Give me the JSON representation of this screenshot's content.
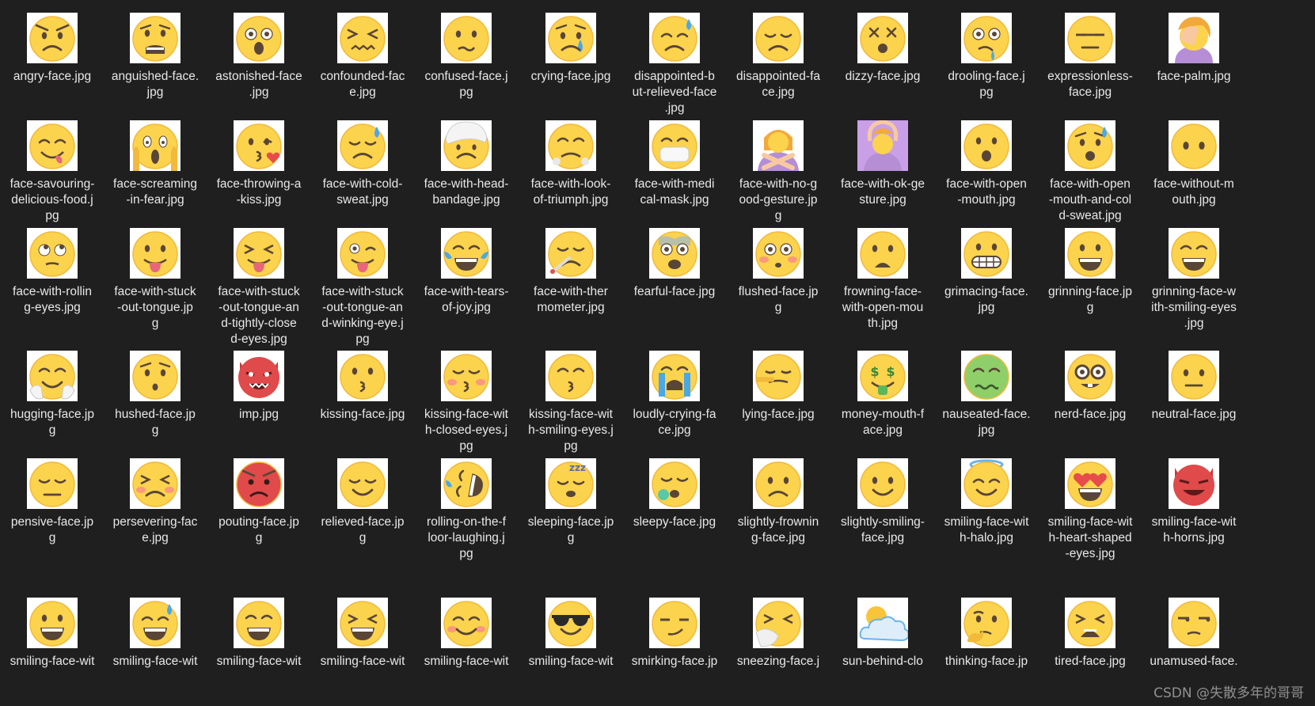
{
  "files": [
    {
      "name": "angry-face.jpg",
      "label": "angry-face.jpg",
      "icon": "angry"
    },
    {
      "name": "anguished-face.jpg",
      "label": "anguished-face.\njpg",
      "icon": "anguished"
    },
    {
      "name": "astonished-face.jpg",
      "label": "astonished-face\n.jpg",
      "icon": "astonished"
    },
    {
      "name": "confounded-face.jpg",
      "label": "confounded-fac\ne.jpg",
      "icon": "confounded"
    },
    {
      "name": "confused-face.jpg",
      "label": "confused-face.j\npg",
      "icon": "confused"
    },
    {
      "name": "crying-face.jpg",
      "label": "crying-face.jpg",
      "icon": "crying"
    },
    {
      "name": "disappointed-but-relieved-face.jpg",
      "label": "disappointed-b\nut-relieved-face\n.jpg",
      "icon": "disappointed-relieved"
    },
    {
      "name": "disappointed-face.jpg",
      "label": "disappointed-fa\nce.jpg",
      "icon": "disappointed"
    },
    {
      "name": "dizzy-face.jpg",
      "label": "dizzy-face.jpg",
      "icon": "dizzy"
    },
    {
      "name": "drooling-face.jpg",
      "label": "drooling-face.j\npg",
      "icon": "drooling"
    },
    {
      "name": "expressionless-face.jpg",
      "label": "expressionless-\nface.jpg",
      "icon": "expressionless"
    },
    {
      "name": "face-palm.jpg",
      "label": "face-palm.jpg",
      "icon": "face-palm"
    },
    {
      "name": "face-savouring-delicious-food.jpg",
      "label": "face-savouring-\ndelicious-food.j\npg",
      "icon": "savouring"
    },
    {
      "name": "face-screaming-in-fear.jpg",
      "label": "face-screaming\n-in-fear.jpg",
      "icon": "screaming"
    },
    {
      "name": "face-throwing-a-kiss.jpg",
      "label": "face-throwing-a\n-kiss.jpg",
      "icon": "throwing-kiss"
    },
    {
      "name": "face-with-cold-sweat.jpg",
      "label": "face-with-cold-\nsweat.jpg",
      "icon": "cold-sweat"
    },
    {
      "name": "face-with-head-bandage.jpg",
      "label": "face-with-head-\nbandage.jpg",
      "icon": "head-bandage"
    },
    {
      "name": "face-with-look-of-triumph.jpg",
      "label": "face-with-look-\nof-triumph.jpg",
      "icon": "triumph"
    },
    {
      "name": "face-with-medical-mask.jpg",
      "label": "face-with-medi\ncal-mask.jpg",
      "icon": "medical-mask"
    },
    {
      "name": "face-with-no-good-gesture.jpg",
      "label": "face-with-no-g\nood-gesture.jp\ng",
      "icon": "no-good-gesture"
    },
    {
      "name": "face-with-ok-gesture.jpg",
      "label": "face-with-ok-ge\nsture.jpg",
      "icon": "ok-gesture"
    },
    {
      "name": "face-with-open-mouth.jpg",
      "label": "face-with-open\n-mouth.jpg",
      "icon": "open-mouth"
    },
    {
      "name": "face-with-open-mouth-and-cold-sweat.jpg",
      "label": "face-with-open\n-mouth-and-col\nd-sweat.jpg",
      "icon": "open-mouth-cold-sweat"
    },
    {
      "name": "face-without-mouth.jpg",
      "label": "face-without-m\nouth.jpg",
      "icon": "without-mouth"
    },
    {
      "name": "face-with-rolling-eyes.jpg",
      "label": "face-with-rollin\ng-eyes.jpg",
      "icon": "rolling-eyes"
    },
    {
      "name": "face-with-stuck-out-tongue.jpg",
      "label": "face-with-stuck\n-out-tongue.jp\ng",
      "icon": "stuck-out-tongue"
    },
    {
      "name": "face-with-stuck-out-tongue-and-tightly-closed-eyes.jpg",
      "label": "face-with-stuck\n-out-tongue-an\nd-tightly-close\nd-eyes.jpg",
      "icon": "tongue-closed-eyes"
    },
    {
      "name": "face-with-stuck-out-tongue-and-winking-eye.jpg",
      "label": "face-with-stuck\n-out-tongue-an\nd-winking-eye.j\npg",
      "icon": "tongue-wink"
    },
    {
      "name": "face-with-tears-of-joy.jpg",
      "label": "face-with-tears-\nof-joy.jpg",
      "icon": "tears-of-joy"
    },
    {
      "name": "face-with-thermometer.jpg",
      "label": "face-with-ther\nmometer.jpg",
      "icon": "thermometer"
    },
    {
      "name": "fearful-face.jpg",
      "label": "fearful-face.jpg",
      "icon": "fearful"
    },
    {
      "name": "flushed-face.jpg",
      "label": "flushed-face.jp\ng",
      "icon": "flushed"
    },
    {
      "name": "frowning-face-with-open-mouth.jpg",
      "label": "frowning-face-\nwith-open-mou\nth.jpg",
      "icon": "frowning-open-mouth"
    },
    {
      "name": "grimacing-face.jpg",
      "label": "grimacing-face.\njpg",
      "icon": "grimacing"
    },
    {
      "name": "grinning-face.jpg",
      "label": "grinning-face.jp\ng",
      "icon": "grinning"
    },
    {
      "name": "grinning-face-with-smiling-eyes.jpg",
      "label": "grinning-face-w\nith-smiling-eyes\n.jpg",
      "icon": "grinning-smiling-eyes"
    },
    {
      "name": "hugging-face.jpg",
      "label": "hugging-face.jp\ng",
      "icon": "hugging"
    },
    {
      "name": "hushed-face.jpg",
      "label": "hushed-face.jp\ng",
      "icon": "hushed"
    },
    {
      "name": "imp.jpg",
      "label": "imp.jpg",
      "icon": "imp"
    },
    {
      "name": "kissing-face.jpg",
      "label": "kissing-face.jpg",
      "icon": "kissing"
    },
    {
      "name": "kissing-face-with-closed-eyes.jpg",
      "label": "kissing-face-wit\nh-closed-eyes.j\npg",
      "icon": "kissing-closed-eyes"
    },
    {
      "name": "kissing-face-with-smiling-eyes.jpg",
      "label": "kissing-face-wit\nh-smiling-eyes.j\npg",
      "icon": "kissing-smiling-eyes"
    },
    {
      "name": "loudly-crying-face.jpg",
      "label": "loudly-crying-fa\nce.jpg",
      "icon": "loudly-crying"
    },
    {
      "name": "lying-face.jpg",
      "label": "lying-face.jpg",
      "icon": "lying"
    },
    {
      "name": "money-mouth-face.jpg",
      "label": "money-mouth-f\nace.jpg",
      "icon": "money-mouth"
    },
    {
      "name": "nauseated-face.jpg",
      "label": "nauseated-face.\njpg",
      "icon": "nauseated"
    },
    {
      "name": "nerd-face.jpg",
      "label": "nerd-face.jpg",
      "icon": "nerd"
    },
    {
      "name": "neutral-face.jpg",
      "label": "neutral-face.jpg",
      "icon": "neutral"
    },
    {
      "name": "pensive-face.jpg",
      "label": "pensive-face.jp\ng",
      "icon": "pensive"
    },
    {
      "name": "persevering-face.jpg",
      "label": "persevering-fac\ne.jpg",
      "icon": "persevering"
    },
    {
      "name": "pouting-face.jpg",
      "label": "pouting-face.jp\ng",
      "icon": "pouting"
    },
    {
      "name": "relieved-face.jpg",
      "label": "relieved-face.jp\ng",
      "icon": "relieved"
    },
    {
      "name": "rolling-on-the-floor-laughing.jpg",
      "label": "rolling-on-the-f\nloor-laughing.j\npg",
      "icon": "rofl"
    },
    {
      "name": "sleeping-face.jpg",
      "label": "sleeping-face.jp\ng",
      "icon": "sleeping"
    },
    {
      "name": "sleepy-face.jpg",
      "label": "sleepy-face.jpg",
      "icon": "sleepy"
    },
    {
      "name": "slightly-frowning-face.jpg",
      "label": "slightly-frownin\ng-face.jpg",
      "icon": "slightly-frowning"
    },
    {
      "name": "slightly-smiling-face.jpg",
      "label": "slightly-smiling-\nface.jpg",
      "icon": "slightly-smiling"
    },
    {
      "name": "smiling-face-with-halo.jpg",
      "label": "smiling-face-wit\nh-halo.jpg",
      "icon": "halo"
    },
    {
      "name": "smiling-face-with-heart-shaped-eyes.jpg",
      "label": "smiling-face-wit\nh-heart-shaped\n-eyes.jpg",
      "icon": "heart-eyes"
    },
    {
      "name": "smiling-face-with-horns.jpg",
      "label": "smiling-face-wit\nh-horns.jpg",
      "icon": "horns"
    },
    {
      "name": "smiling-face-wit…",
      "label": "smiling-face-wit",
      "icon": "smiling-open-mouth"
    },
    {
      "name": "smiling-face-wit…",
      "label": "smiling-face-wit",
      "icon": "smiling-cold-sweat"
    },
    {
      "name": "smiling-face-wit…",
      "label": "smiling-face-wit",
      "icon": "smiling-eyes-open"
    },
    {
      "name": "smiling-face-wit…",
      "label": "smiling-face-wit",
      "icon": "laughing"
    },
    {
      "name": "smiling-face-wit…",
      "label": "smiling-face-wit",
      "icon": "blush"
    },
    {
      "name": "smiling-face-wit…",
      "label": "smiling-face-wit",
      "icon": "sunglasses"
    },
    {
      "name": "smirking-face.jp…",
      "label": "smirking-face.jp",
      "icon": "smirking"
    },
    {
      "name": "sneezing-face.j…",
      "label": "sneezing-face.j",
      "icon": "sneezing"
    },
    {
      "name": "sun-behind-clo…",
      "label": "sun-behind-clo",
      "icon": "sun-cloud"
    },
    {
      "name": "thinking-face.jp…",
      "label": "thinking-face.jp",
      "icon": "thinking"
    },
    {
      "name": "tired-face.jpg",
      "label": "tired-face.jpg",
      "icon": "tired"
    },
    {
      "name": "unamused-face.…",
      "label": "unamused-face.",
      "icon": "unamused"
    }
  ],
  "watermark": "CSDN @失散多年的哥哥",
  "colors": {
    "background": "#1f1f1f",
    "face": "#fcd34d",
    "face_shade": "#f2b93b",
    "feature": "#5a4636"
  }
}
